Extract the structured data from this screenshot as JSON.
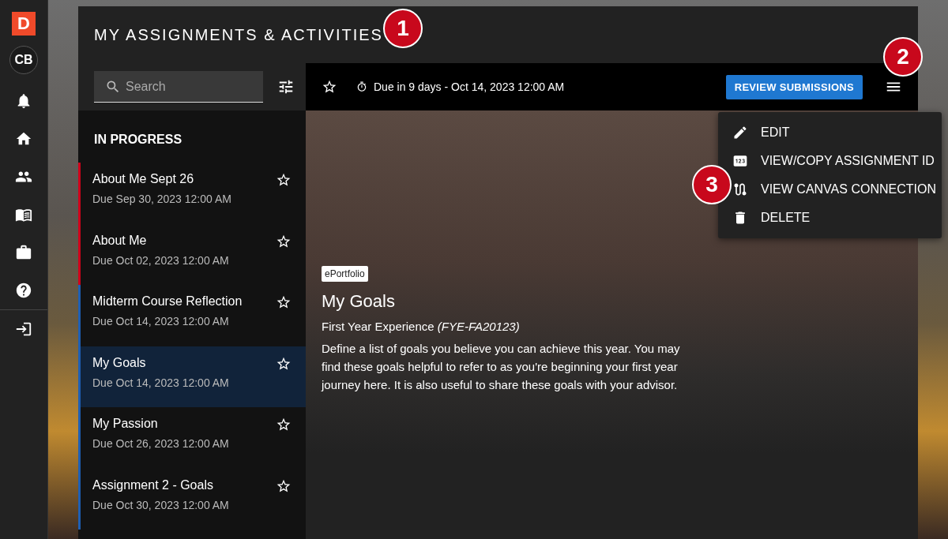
{
  "nav": {
    "logo": "D",
    "avatar": "CB"
  },
  "panel": {
    "title": "MY ASSIGNMENTS & ACTIVITIES"
  },
  "search": {
    "placeholder": "Search"
  },
  "list": {
    "heading": "IN PROGRESS",
    "items": [
      {
        "title": "About Me Sept 26",
        "due": "Due Sep 30, 2023 12:00 AM",
        "color": "#d0021b",
        "selected": false
      },
      {
        "title": "About Me",
        "due": "Due Oct 02, 2023 12:00 AM",
        "color": "#d0021b",
        "selected": false
      },
      {
        "title": "Midterm Course Reflection",
        "due": "Due Oct 14, 2023 12:00 AM",
        "color": "#1e5fb4",
        "selected": false
      },
      {
        "title": "My Goals",
        "due": "Due Oct 14, 2023 12:00 AM",
        "color": "#1e5fb4",
        "selected": true
      },
      {
        "title": "My Passion",
        "due": "Due Oct 26, 2023 12:00 AM",
        "color": "#1e5fb4",
        "selected": false
      },
      {
        "title": "Assignment 2 - Goals",
        "due": "Due Oct 30, 2023 12:00 AM",
        "color": "#1e5fb4",
        "selected": false
      }
    ]
  },
  "toolbar": {
    "due": "Due in 9 days - Oct 14, 2023 12:00 AM",
    "button": "REVIEW SUBMISSIONS"
  },
  "menu": {
    "items": [
      {
        "kind": "edit",
        "label": "EDIT"
      },
      {
        "kind": "id",
        "label": "VIEW/COPY ASSIGNMENT ID"
      },
      {
        "kind": "connection",
        "label": "VIEW CANVAS CONNECTION"
      },
      {
        "kind": "delete",
        "label": "DELETE"
      }
    ]
  },
  "detail": {
    "tag": "ePortfolio",
    "title": "My Goals",
    "course": "First Year Experience *(FYE-FA20123)*",
    "description": "Define a list of goals you believe you can achieve this year. You may find these goals helpful to refer to as you're beginning your first year journey here. It is also useful to share these goals with your advisor."
  },
  "callouts": [
    {
      "label": "1"
    },
    {
      "label": "2"
    },
    {
      "label": "3"
    }
  ]
}
